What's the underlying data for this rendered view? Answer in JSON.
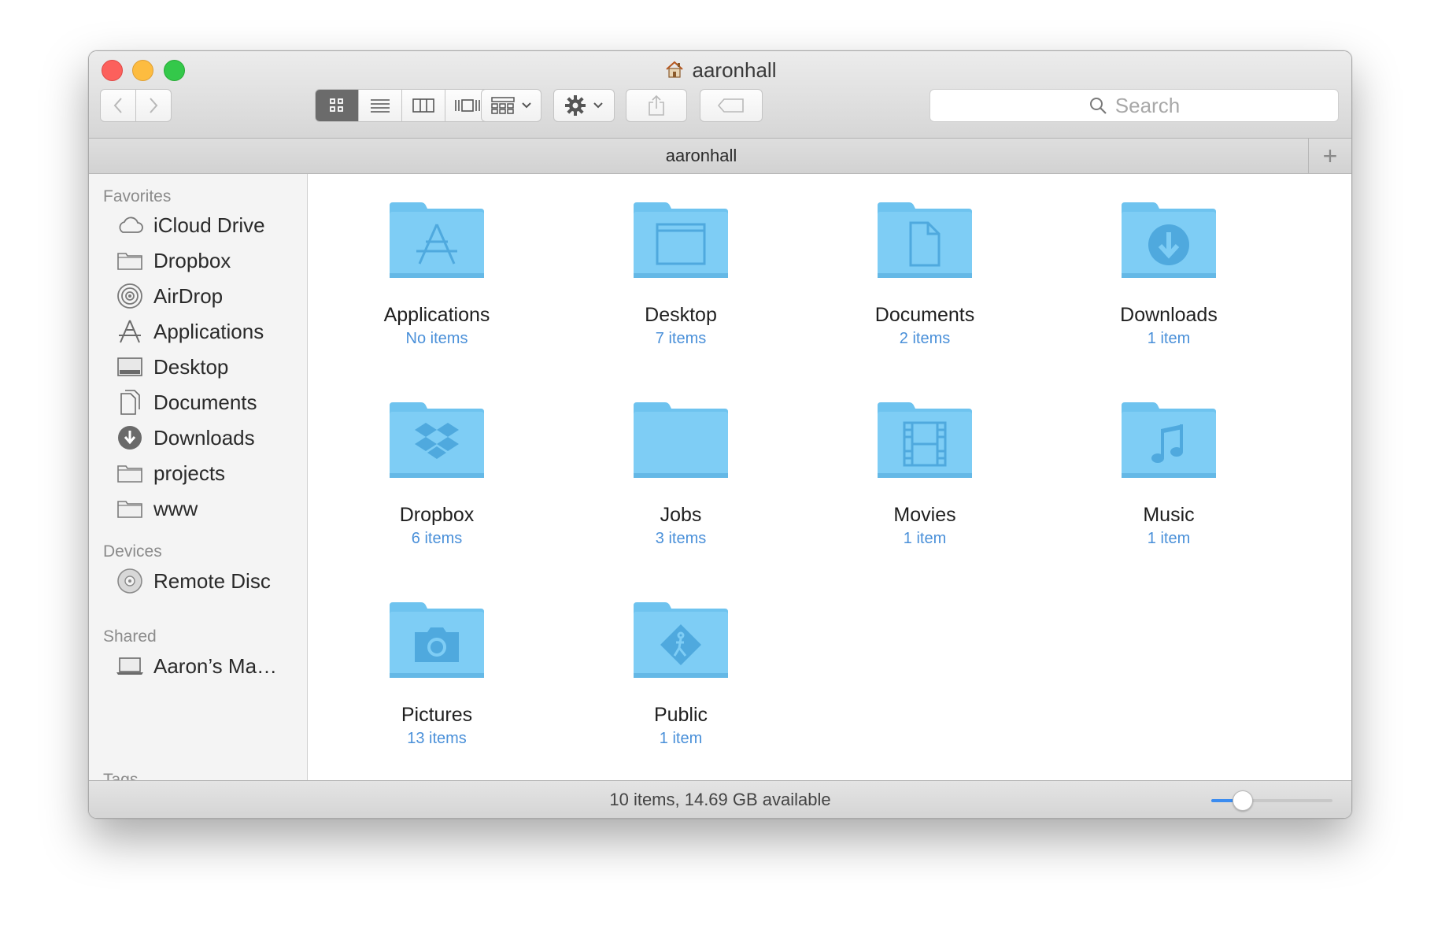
{
  "window": {
    "title": "aaronhall"
  },
  "toolbar": {
    "search_placeholder": "Search",
    "view_modes": [
      "icon",
      "list",
      "column",
      "cover-flow"
    ],
    "active_view": "icon"
  },
  "pathbar": {
    "label": "aaronhall",
    "add_symbol": "+"
  },
  "sidebar": {
    "favorites_header": "Favorites",
    "favorites": [
      {
        "label": "iCloud Drive",
        "icon": "cloud-icon"
      },
      {
        "label": "Dropbox",
        "icon": "folder-icon"
      },
      {
        "label": "AirDrop",
        "icon": "airdrop-icon"
      },
      {
        "label": "Applications",
        "icon": "applications-icon"
      },
      {
        "label": "Desktop",
        "icon": "desktop-icon"
      },
      {
        "label": "Documents",
        "icon": "documents-icon"
      },
      {
        "label": "Downloads",
        "icon": "downloads-icon"
      },
      {
        "label": "projects",
        "icon": "folder-icon"
      },
      {
        "label": "www",
        "icon": "folder-icon"
      }
    ],
    "devices_header": "Devices",
    "devices": [
      {
        "label": "Remote Disc",
        "icon": "disc-icon"
      }
    ],
    "shared_header": "Shared",
    "shared": [
      {
        "label": "Aaron’s Ma…",
        "icon": "laptop-icon"
      }
    ],
    "tags_header": "Tags"
  },
  "items": [
    {
      "name": "Applications",
      "count": "No items",
      "glyph": "applications"
    },
    {
      "name": "Desktop",
      "count": "7 items",
      "glyph": "desktop"
    },
    {
      "name": "Documents",
      "count": "2 items",
      "glyph": "documents"
    },
    {
      "name": "Downloads",
      "count": "1 item",
      "glyph": "downloads"
    },
    {
      "name": "Dropbox",
      "count": "6 items",
      "glyph": "dropbox"
    },
    {
      "name": "Jobs",
      "count": "3 items",
      "glyph": "plain"
    },
    {
      "name": "Movies",
      "count": "1 item",
      "glyph": "movies"
    },
    {
      "name": "Music",
      "count": "1 item",
      "glyph": "music"
    },
    {
      "name": "Pictures",
      "count": "13 items",
      "glyph": "pictures"
    },
    {
      "name": "Public",
      "count": "1 item",
      "glyph": "public"
    }
  ],
  "status": {
    "text": "10 items, 14.69 GB available",
    "icon_size_fraction": 0.22
  },
  "colors": {
    "folder": "#7ecdf5",
    "folder_tab": "#6ec3ef",
    "glyph": "#4fa9de",
    "count": "#4a90d9"
  }
}
